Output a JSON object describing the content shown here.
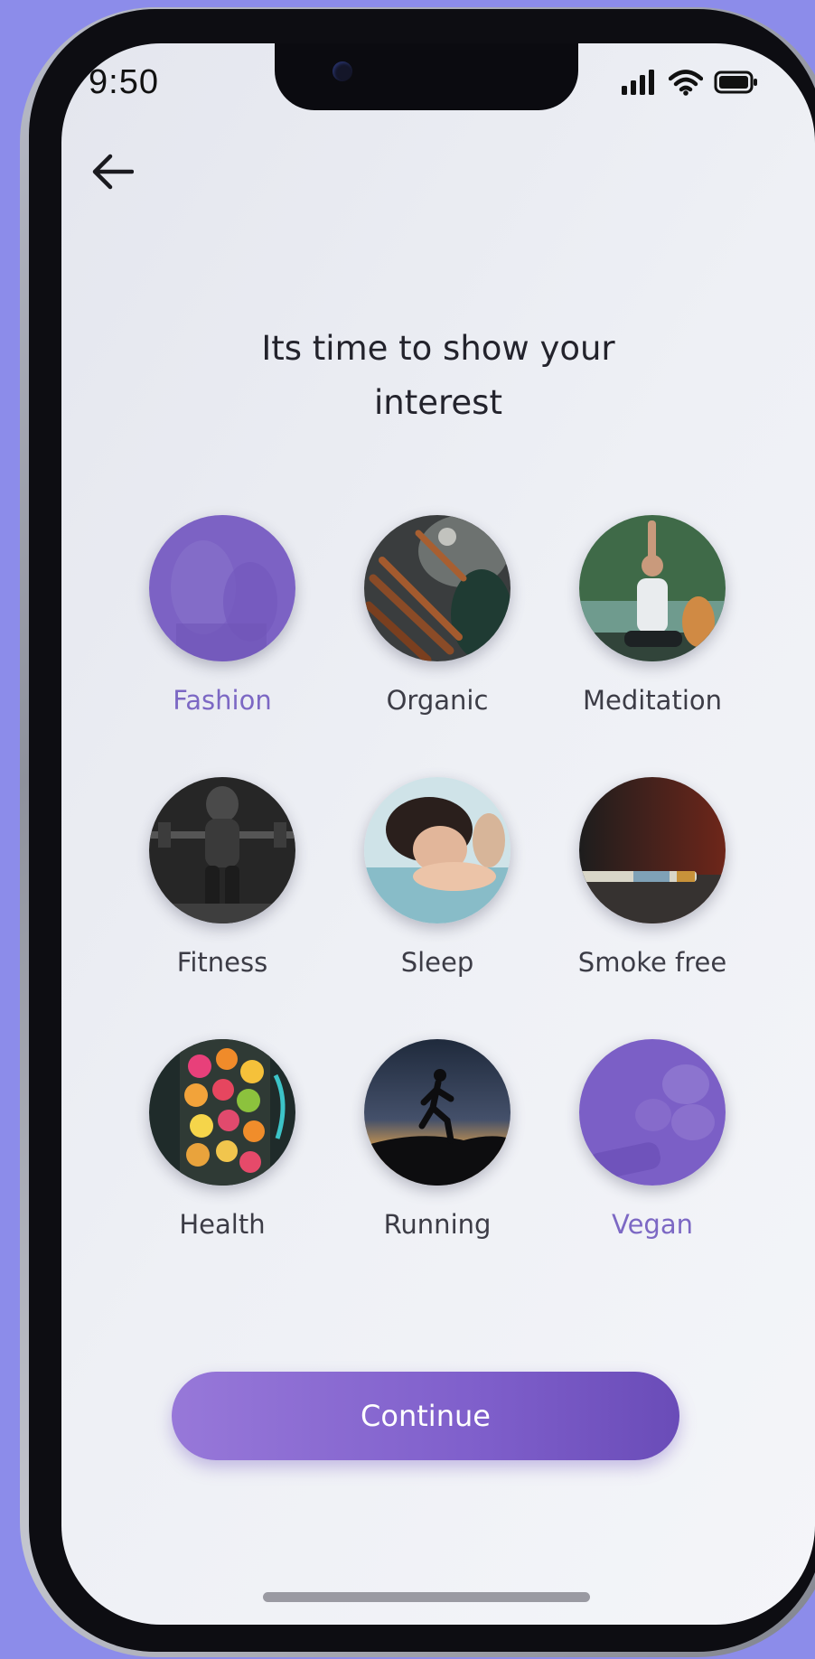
{
  "status_bar": {
    "time": "9:50",
    "icons": [
      "signal-icon",
      "wifi-icon",
      "battery-icon"
    ]
  },
  "header": {
    "back_icon": "arrow-left-icon"
  },
  "main": {
    "title_line1": "Its time to show your",
    "title_line2": "interest",
    "interests": [
      {
        "label": "Fashion",
        "selected": true
      },
      {
        "label": "Organic",
        "selected": false
      },
      {
        "label": "Meditation",
        "selected": false
      },
      {
        "label": "Fitness",
        "selected": false
      },
      {
        "label": "Sleep",
        "selected": false
      },
      {
        "label": "Smoke free",
        "selected": false
      },
      {
        "label": "Health",
        "selected": false
      },
      {
        "label": "Running",
        "selected": false
      },
      {
        "label": "Vegan",
        "selected": true
      }
    ]
  },
  "footer": {
    "continue_label": "Continue"
  },
  "colors": {
    "accent": "#7c68c4",
    "button_start": "#9778d9",
    "button_end": "#6a4cb8",
    "background": "#8c8cea"
  }
}
